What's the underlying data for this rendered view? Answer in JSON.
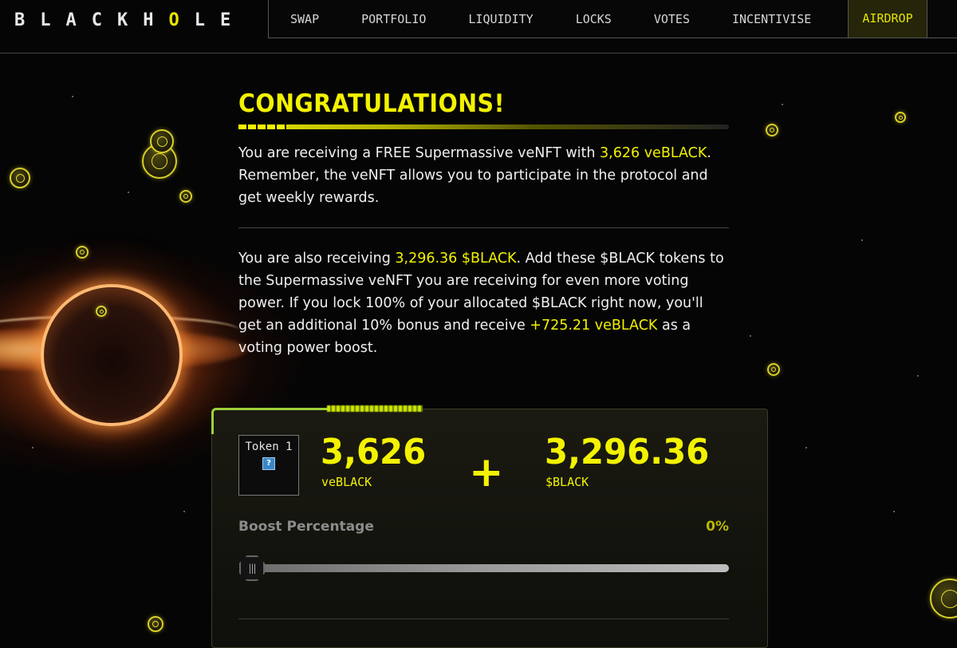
{
  "app": {
    "logo_text_a": "BLACKH",
    "logo_text_o": "O",
    "logo_text_b": "LE"
  },
  "nav": {
    "items": [
      {
        "label": "SWAP"
      },
      {
        "label": "PORTFOLIO"
      },
      {
        "label": "LIQUIDITY"
      },
      {
        "label": "LOCKS"
      },
      {
        "label": "VOTES"
      },
      {
        "label": "INCENTIVISE"
      }
    ],
    "active": {
      "label": "AIRDROP"
    }
  },
  "main": {
    "title": "CONGRATULATIONS!",
    "p1": {
      "t1": "You are receiving a FREE Supermassive veNFT with ",
      "h1": "3,626 veBLACK",
      "t2": ". Remember, the veNFT allows you to participate in the protocol and get weekly rewards."
    },
    "p2": {
      "t1": "You are also receiving ",
      "h1": "3,296.36 $BLACK",
      "t2": ". Add these $BLACK tokens to the Supermassive veNFT you are receiving for even more voting power. If you lock 100% of your allocated $BLACK right now, you'll get an additional 10% bonus and receive ",
      "h2": "+725.21 veBLACK",
      "t3": " as a voting power boost."
    }
  },
  "card": {
    "token_label": "Token 1",
    "token_icon": "?",
    "amount1": "3,626",
    "unit1": "veBLACK",
    "plus": "+",
    "amount2": "3,296.36",
    "unit2": "$BLACK",
    "boost_label": "Boost Percentage",
    "boost_value": "0%",
    "boost_fraction": 0,
    "slider_handle_glyph": "|||"
  },
  "colors": {
    "accent": "#f2f200",
    "background": "#050505",
    "text": "#f0f0f0"
  },
  "icons": {
    "coins": "coin-icon",
    "token": "token-placeholder-icon",
    "slider": "slider-handle-icon"
  }
}
